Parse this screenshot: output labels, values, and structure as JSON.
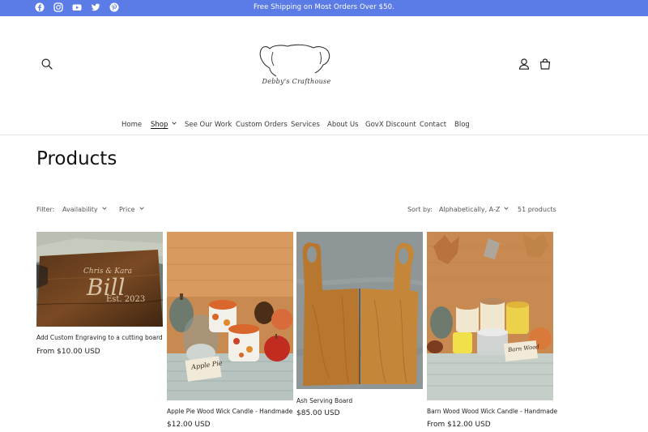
{
  "announcement": {
    "text": "Free Shipping on Most Orders Over $50."
  },
  "social": [
    "facebook-icon",
    "instagram-icon",
    "youtube-icon",
    "twitter-icon",
    "pinterest-icon"
  ],
  "logo": {
    "text": "Debby's Crafthouse"
  },
  "nav": {
    "items": [
      {
        "label": "Home"
      },
      {
        "label": "Shop"
      },
      {
        "label": "See Our Work"
      },
      {
        "label": "Custom Orders"
      },
      {
        "label": "Services"
      },
      {
        "label": "About Us"
      },
      {
        "label": "GovX Discount"
      },
      {
        "label": "Contact"
      },
      {
        "label": "Blog"
      }
    ]
  },
  "page": {
    "title": "Products"
  },
  "filters": {
    "label": "Filter:",
    "availability": "Availability",
    "price": "Price",
    "sort_label": "Sort by:",
    "sort_value": "Alphabetically, A-Z",
    "count": "51 products"
  },
  "products": [
    {
      "title": "Add Custom Engraving to a cutting board",
      "price": "From $10.00 USD",
      "engraving": {
        "line1": "Chris & Kara",
        "line2": "Bill",
        "line3": "Est. 2023"
      }
    },
    {
      "title": "Apple Pie Wood Wick Candle - Handmade",
      "price": "$12.00 USD",
      "tag": "Apple Pie"
    },
    {
      "title": "Ash Serving Board",
      "price": "$85.00 USD"
    },
    {
      "title": "Barn Wood Wood Wick Candle - Handmade",
      "price": "From $12.00 USD",
      "tag": "Barn Wood"
    }
  ],
  "colors": {
    "announcement_bg": "#5b7ce6",
    "text": "#121212"
  }
}
